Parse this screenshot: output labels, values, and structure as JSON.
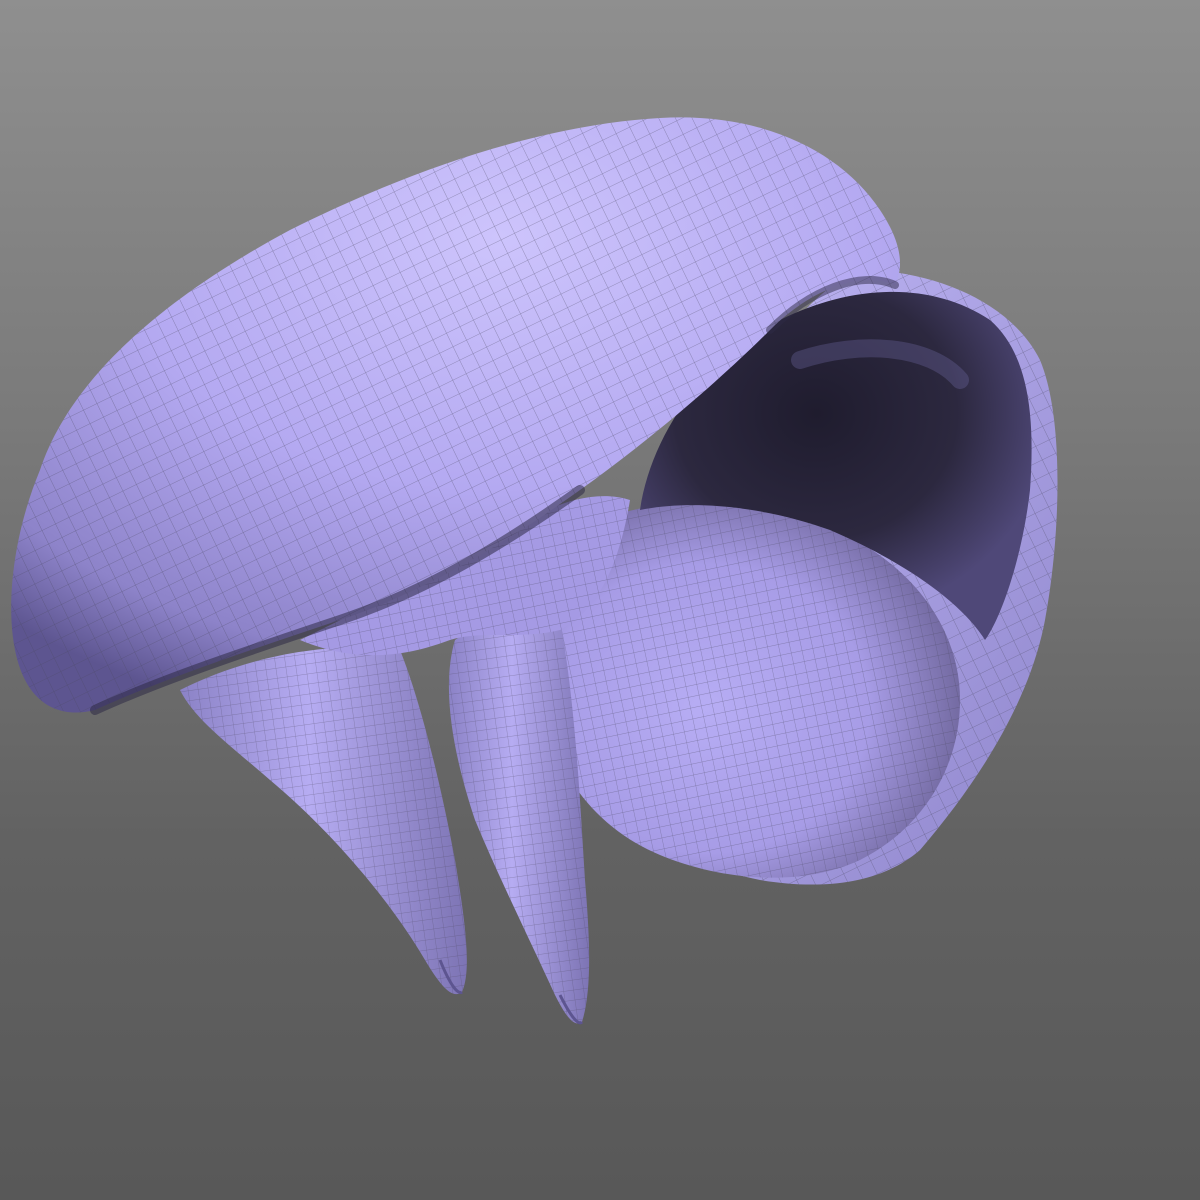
{
  "viewport": {
    "background_top": "#8f8f8f",
    "background_bottom": "#585858"
  },
  "model": {
    "icon": "sculpt-mesh",
    "base_color": "#b3a8f2",
    "highlight_color": "#cbc2fb",
    "shadow_color": "#4a4370",
    "wire_color": "#4b4660",
    "parts": [
      "shell",
      "cavity",
      "inner-lobe",
      "tusk-left",
      "tusk-right"
    ],
    "wireframe_visible": true
  }
}
